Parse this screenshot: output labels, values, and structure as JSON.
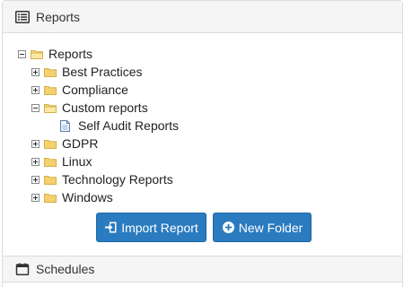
{
  "reports_panel": {
    "title": "Reports",
    "icon": "list-alt-icon"
  },
  "tree": {
    "root": {
      "label": "Reports",
      "state": "expanded"
    },
    "items": [
      {
        "label": "Best Practices",
        "state": "collapsed"
      },
      {
        "label": "Compliance",
        "state": "collapsed"
      },
      {
        "label": "Custom reports",
        "state": "expanded",
        "children": [
          {
            "label": "Self Audit Reports"
          }
        ]
      },
      {
        "label": "GDPR",
        "state": "collapsed"
      },
      {
        "label": "Linux",
        "state": "collapsed"
      },
      {
        "label": "Technology Reports",
        "state": "collapsed"
      },
      {
        "label": "Windows",
        "state": "collapsed"
      }
    ]
  },
  "buttons": {
    "import_label": "Import Report",
    "import_icon": "import-icon",
    "new_folder_label": "New Folder",
    "new_folder_icon": "plus-circle-icon"
  },
  "schedules_panel": {
    "title": "Schedules",
    "icon": "calendar-icon"
  },
  "colors": {
    "primary_button": "#2a7bbf",
    "folder": "#f4d06f",
    "heading_bg": "#f5f5f5"
  }
}
